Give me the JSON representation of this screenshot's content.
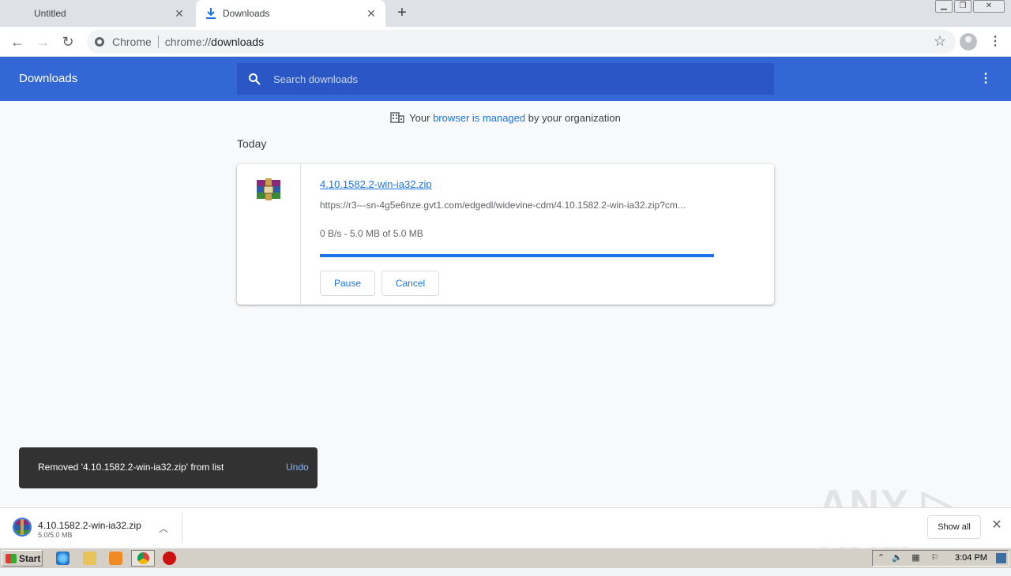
{
  "tabs": [
    {
      "label": "Untitled",
      "active": false
    },
    {
      "label": "Downloads",
      "active": true
    }
  ],
  "omnibox": {
    "site_label": "Chrome",
    "url_scheme": "chrome://",
    "url_rest": "downloads"
  },
  "header": {
    "title": "Downloads",
    "search_placeholder": "Search downloads"
  },
  "managed_notice": {
    "prefix": "Your ",
    "link": "browser is managed",
    "suffix": " by your organization"
  },
  "section": {
    "label": "Today"
  },
  "download": {
    "file_name": "4.10.1582.2-win-ia32.zip",
    "url": "https://r3---sn-4g5e6nze.gvt1.com/edgedl/widevine-cdm/4.10.1582.2-win-ia32.zip?cm...",
    "status": "0 B/s - 5.0 MB of 5.0 MB",
    "progress_percent": 100,
    "pause_label": "Pause",
    "cancel_label": "Cancel"
  },
  "toast": {
    "message": "Removed '4.10.1582.2-win-ia32.zip' from list",
    "undo_label": "Undo"
  },
  "shelf": {
    "file_name": "4.10.1582.2-win-ia32.zip",
    "size": "5.0/5.0 MB",
    "show_all_label": "Show all"
  },
  "taskbar": {
    "start_label": "Start",
    "clock": "3:04 PM"
  },
  "watermark": "ANY RUN",
  "colors": {
    "header_blue": "#3367d6",
    "link_blue": "#1a73e8",
    "toast_bg": "#323232"
  }
}
